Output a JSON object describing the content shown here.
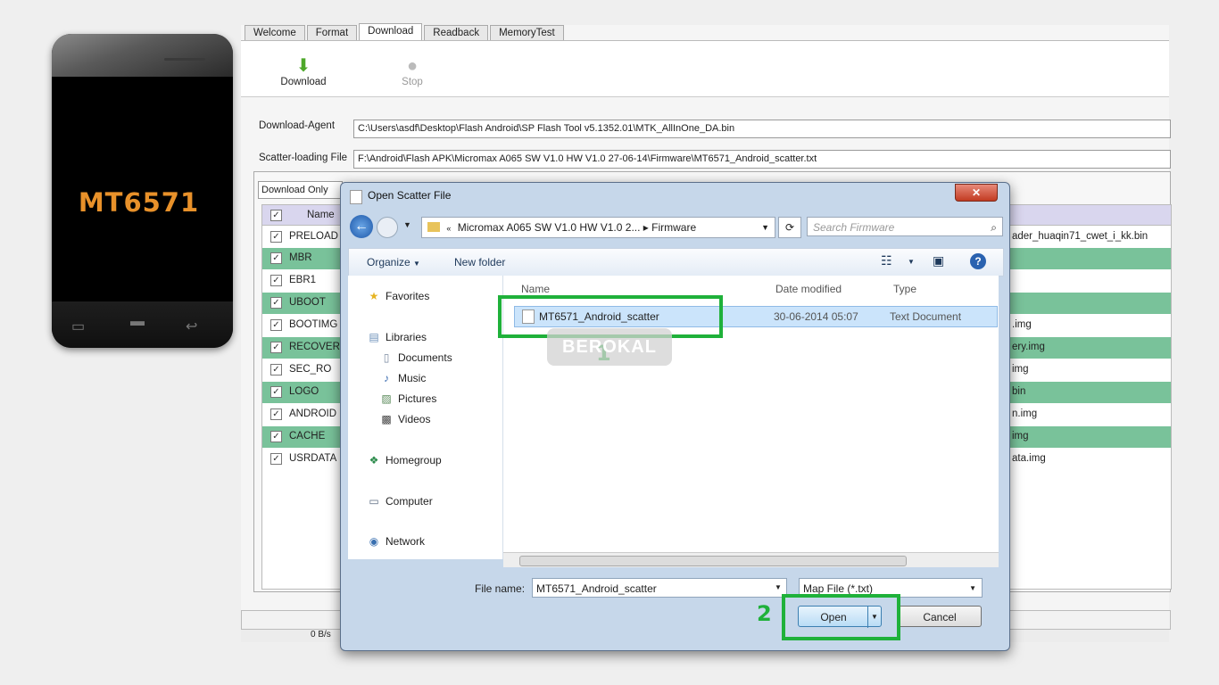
{
  "phone": {
    "label": "MT6571"
  },
  "app": {
    "tabs": [
      "Welcome",
      "Format",
      "Download",
      "Readback",
      "MemoryTest"
    ],
    "toolbar": {
      "download": "Download",
      "stop": "Stop"
    },
    "download_agent_label": "Download-Agent",
    "download_agent_path": "C:\\Users\\asdf\\Desktop\\Flash Android\\SP Flash Tool v5.1352.01\\MTK_AllInOne_DA.bin",
    "scatter_label": "Scatter-loading File",
    "scatter_path": "F:\\Android\\Flash APK\\Micromax A065 SW V1.0 HW V1.0 27-06-14\\Firmware\\MT6571_Android_scatter.txt",
    "mode": "Download Only",
    "grid_header": "Name",
    "rows": [
      {
        "name": "PRELOAD",
        "location": "ader_huaqin71_cwet_i_kk.bin"
      },
      {
        "name": "MBR",
        "location": ""
      },
      {
        "name": "EBR1",
        "location": ""
      },
      {
        "name": "UBOOT",
        "location": ""
      },
      {
        "name": "BOOTIMG",
        "location": ".img"
      },
      {
        "name": "RECOVERY",
        "location": "ery.img"
      },
      {
        "name": "SEC_RO",
        "location": "img"
      },
      {
        "name": "LOGO",
        "location": "bin"
      },
      {
        "name": "ANDROID",
        "location": "n.img"
      },
      {
        "name": "CACHE",
        "location": "img"
      },
      {
        "name": "USRDATA",
        "location": "ata.img"
      }
    ],
    "status_speed": "0 B/s"
  },
  "dialog": {
    "title": "Open Scatter File",
    "address": "Micromax A065 SW V1.0 HW V1.0 2...  ▸  Firmware",
    "search_placeholder": "Search Firmware",
    "organize": "Organize",
    "new_folder": "New folder",
    "nav": {
      "favorites": "Favorites",
      "libraries": "Libraries",
      "documents": "Documents",
      "music": "Music",
      "pictures": "Pictures",
      "videos": "Videos",
      "homegroup": "Homegroup",
      "computer": "Computer",
      "network": "Network"
    },
    "columns": {
      "name": "Name",
      "date": "Date modified",
      "type": "Type"
    },
    "file": {
      "name": "MT6571_Android_scatter",
      "date": "30-06-2014 05:07",
      "type": "Text Document"
    },
    "filename_label": "File name:",
    "filename_value": "MT6571_Android_scatter",
    "filter": "Map File (*.txt)",
    "open": "Open",
    "cancel": "Cancel"
  },
  "annotations": {
    "step1": "1",
    "step2": "2",
    "watermark": "BEROKAL"
  },
  "colors": {
    "highlight": "#1fb13a",
    "row_green": "#79c29a",
    "phone_label": "#e8912a"
  }
}
